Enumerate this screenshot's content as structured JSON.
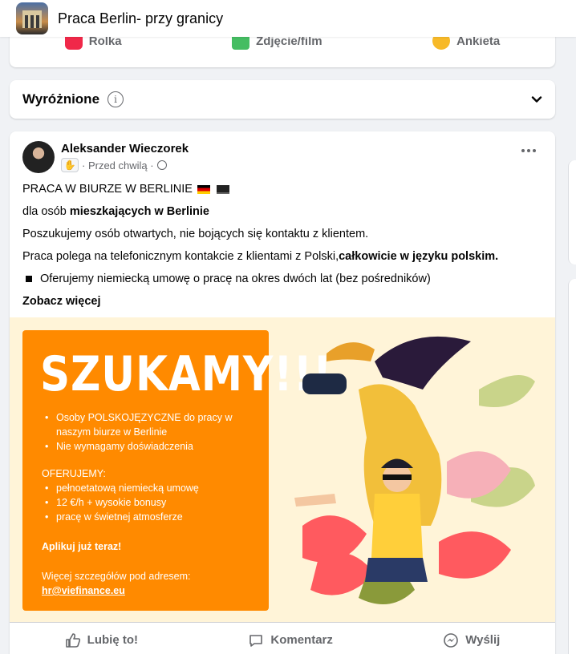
{
  "header": {
    "group_name": "Praca Berlin- przy granicy"
  },
  "composer": {
    "reel_label": "Rolka",
    "photo_label": "Zdjęcie/film",
    "poll_label": "Ankieta"
  },
  "featured": {
    "title": "Wyróżnione",
    "info_glyph": "i"
  },
  "post": {
    "author": "Aleksander Wieczorek",
    "badge_icon": "waving-hand-icon",
    "time": "Przed chwilą",
    "line1": "PRACA W BIURZE W BERLINIE",
    "line2_prefix": "dla osób ",
    "line2_bold": "mieszkających w Berlinie",
    "line3": "Poszukujemy osób otwartych, nie bojących się kontaktu z klientem.",
    "line4_prefix": "Praca polega na telefonicznym kontakcie z klientami z Polski,",
    "line4_bold": "całkowicie w języku polskim.",
    "line5": "Oferujemy niemiecką umowę o pracę na okres dwóch lat (bez pośredników)",
    "see_more": "Zobacz więcej",
    "image": {
      "headline": "SZUKAMY!!!",
      "list1": [
        "Osoby POLSKOJĘZYCZNE do pracy w naszym biurze w Berlinie",
        "Nie wymagamy doświadczenia"
      ],
      "offer_title": "OFERUJEMY:",
      "list2": [
        "pełnoetatową niemiecką umowę",
        "12 €/h + wysokie bonusy",
        "pracę w świetnej atmosferze"
      ],
      "cta": "Aplikuj już teraz!",
      "details": "Więcej szczegółów pod adresem:",
      "email": "hr@viefinance.eu"
    }
  },
  "actions": {
    "like": "Lubię to!",
    "comment": "Komentarz",
    "send": "Wyślij"
  },
  "colors": {
    "accent_orange": "#ff8a00",
    "background": "#f0f2f5",
    "text_secondary": "#65676b"
  }
}
